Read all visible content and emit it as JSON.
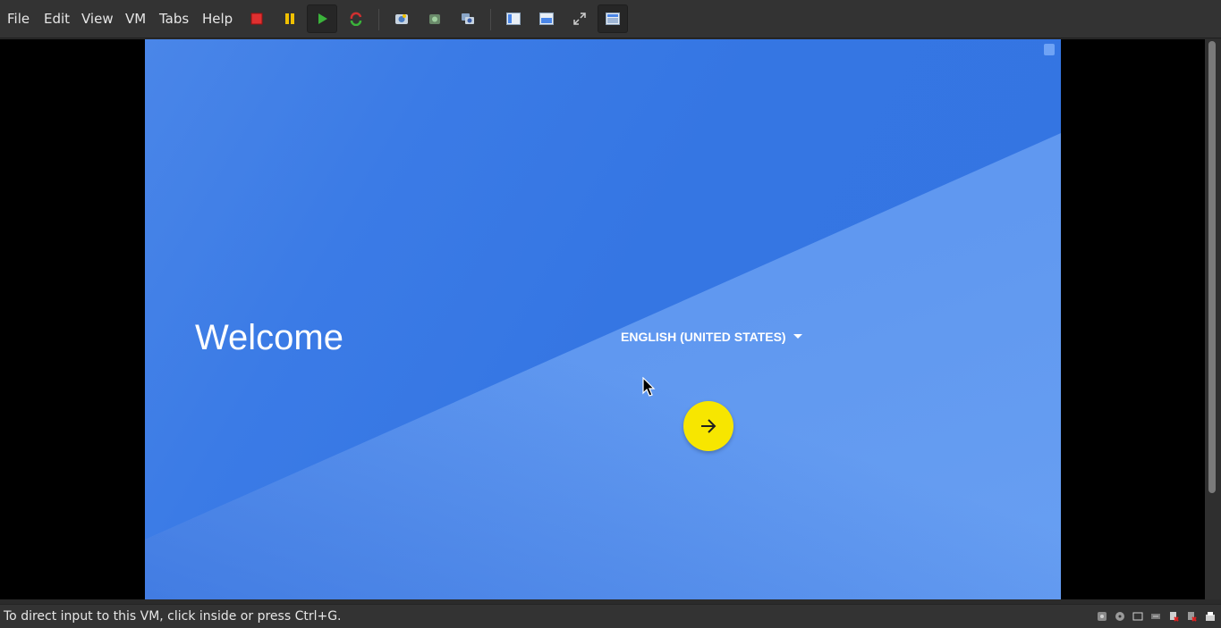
{
  "menu": {
    "file": "File",
    "edit": "Edit",
    "view": "View",
    "vm": "VM",
    "tabs": "Tabs",
    "help": "Help"
  },
  "toolbar": {
    "buttons": [
      {
        "name": "power-off-icon",
        "color": "#e03030"
      },
      {
        "name": "pause-icon",
        "color": "#f0c000"
      },
      {
        "name": "play-icon",
        "color": "#3bb33b",
        "active": true
      },
      {
        "name": "reset-icon",
        "color": "#d03030"
      },
      {
        "name": "snapshot-icon"
      },
      {
        "name": "revert-snapshot-icon"
      },
      {
        "name": "manage-snapshots-icon"
      },
      {
        "name": "library-icon"
      },
      {
        "name": "console-view-icon"
      },
      {
        "name": "fullscreen-icon"
      },
      {
        "name": "unity-view-icon",
        "active": true
      }
    ]
  },
  "guest": {
    "welcome_text": "Welcome",
    "language_label": "ENGLISH (UNITED STATES)",
    "next_button_icon": "arrow-right-icon",
    "colors": {
      "background_dark": "#3576e3",
      "background_light": "#6199f0",
      "next_button": "#f7e600"
    }
  },
  "status": {
    "message": "To direct input to this VM, click inside or press Ctrl+G.",
    "icons": [
      "hard-disk-icon",
      "cd-drive-icon",
      "floppy-icon",
      "network-icon",
      "usb-icon",
      "sound-icon",
      "printer-icon"
    ]
  }
}
